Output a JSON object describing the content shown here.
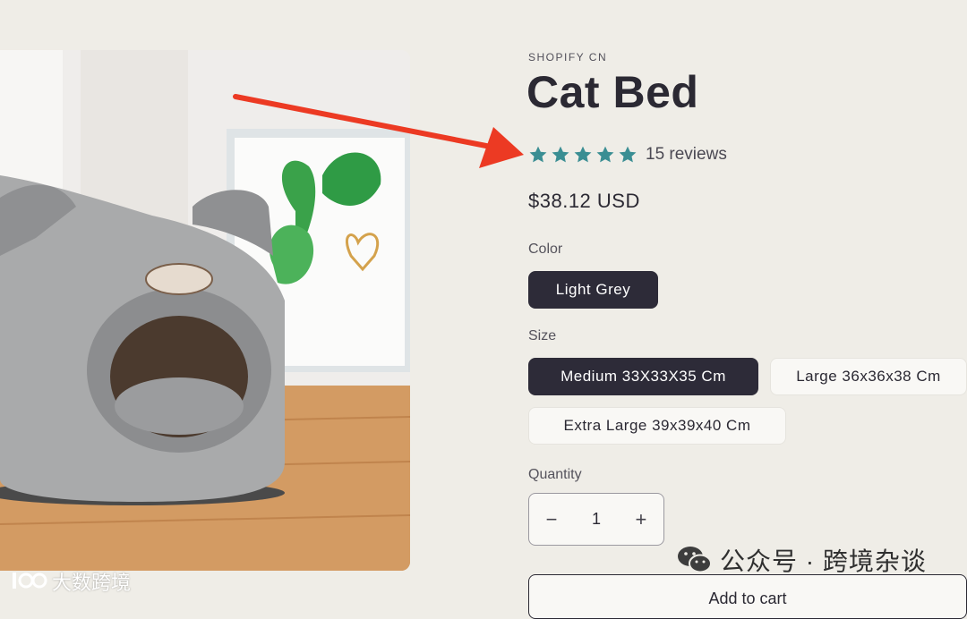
{
  "product": {
    "vendor": "SHOPIFY CN",
    "title": "Cat Bed",
    "rating": {
      "stars": 5,
      "review_text": "15 reviews"
    },
    "price": "$38.12 USD"
  },
  "colors": {
    "star": "#3a8e93",
    "selected_bg": "#2d2b38",
    "arrow": "#ec3a23",
    "page_bg": "#efede7"
  },
  "options": {
    "color": {
      "label": "Color",
      "values": [
        "Light Grey"
      ],
      "selected": "Light Grey"
    },
    "size": {
      "label": "Size",
      "values": [
        "Medium 33X33X35 Cm",
        "Large 36x36x38 Cm",
        "Extra Large 39x39x40 Cm"
      ],
      "selected": "Medium 33X33X35 Cm"
    }
  },
  "quantity": {
    "label": "Quantity",
    "value": "1",
    "minus": "−",
    "plus": "+"
  },
  "cart": {
    "add_label": "Add to cart"
  },
  "watermarks": {
    "right": "公众号 · 跨境杂谈",
    "left": "大数跨境"
  },
  "icons": {
    "star": "star-icon",
    "minus": "minus-icon",
    "plus": "plus-icon",
    "wechat": "wechat-icon",
    "arrow": "annotation-arrow"
  }
}
